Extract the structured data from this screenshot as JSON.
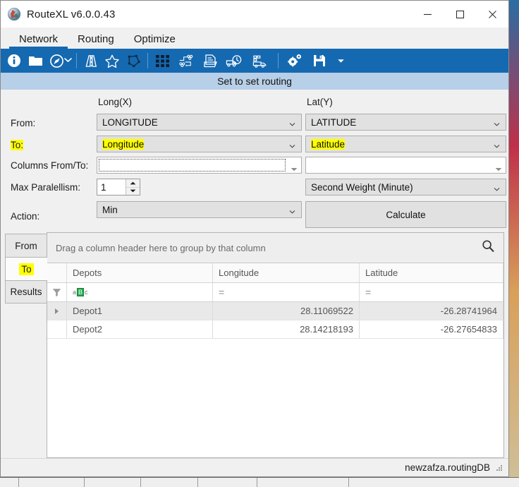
{
  "window": {
    "title": "RouteXL v6.0.0.43",
    "app_icon": "globe-icon",
    "minimize_label": "Minimize",
    "maximize_label": "Maximize",
    "close_label": "Close"
  },
  "menubar": {
    "items": [
      {
        "label": "Network",
        "active": true
      },
      {
        "label": "Routing",
        "active": false
      },
      {
        "label": "Optimize",
        "active": false
      }
    ]
  },
  "toolbar": {
    "icons": [
      "info-icon",
      "open-folder-icon",
      "compass-icon",
      "dropdown-caret-icon",
      "road-icon",
      "star-icon",
      "polygon-icon",
      "matrix-grid-icon",
      "network-nodes-icon",
      "document-folder-icon",
      "truck-clock-icon",
      "truck-delivery-icon",
      "settings-gear-icon",
      "save-disk-icon",
      "overflow-caret-icon"
    ]
  },
  "subheader": {
    "title": "Set to set routing"
  },
  "form": {
    "column_headers": {
      "long": "Long(X)",
      "lat": "Lat(Y)"
    },
    "rows": [
      {
        "label": "From:",
        "label_highlighted": false,
        "long_value": "LONGITUDE",
        "long_highlighted": false,
        "lat_value": "LATITUDE",
        "lat_highlighted": false
      },
      {
        "label": "To:",
        "label_highlighted": true,
        "long_value": "Longitude",
        "long_highlighted": true,
        "lat_value": "Latitude",
        "lat_highlighted": true
      }
    ],
    "columns_from_to": {
      "label": "Columns From/To:",
      "left_value": "",
      "left_placeholder": "",
      "right_value": "",
      "right_placeholder": ""
    },
    "max_parallelism": {
      "label": "Max Paralellism:",
      "value": "1"
    },
    "weight": {
      "value": "Second Weight (Minute)"
    },
    "action": {
      "label": "Action:",
      "value": "Min"
    },
    "calculate_button": {
      "label": "Calculate"
    }
  },
  "grid": {
    "tabs": [
      {
        "label": "From",
        "active": false,
        "highlighted": false
      },
      {
        "label": "To",
        "active": true,
        "highlighted": true
      },
      {
        "label": "Results",
        "active": false,
        "highlighted": false
      }
    ],
    "group_panel_text": "Drag a column header here to group by that column",
    "search_icon": "magnifier-icon",
    "columns": [
      "Depots",
      "Longitude",
      "Latitude"
    ],
    "filter_row": {
      "filter_icon": "funnel-icon",
      "depots_op": "abc",
      "longitude_op": "=",
      "latitude_op": "="
    },
    "rows": [
      {
        "depots": "Depot1",
        "longitude": "28.11069522",
        "latitude": "-26.28741964",
        "selected": true
      },
      {
        "depots": "Depot2",
        "longitude": "28.14218193",
        "latitude": "-26.27654833",
        "selected": false
      }
    ]
  },
  "statusbar": {
    "text": "newzafza.routingDB",
    "grip": "resize-grip-icon"
  },
  "colors": {
    "toolbar_blue": "#1569b0",
    "subheader_blue": "#b8cfe8",
    "highlight_yellow": "#ffff00",
    "window_bg": "#f0f0f0"
  }
}
